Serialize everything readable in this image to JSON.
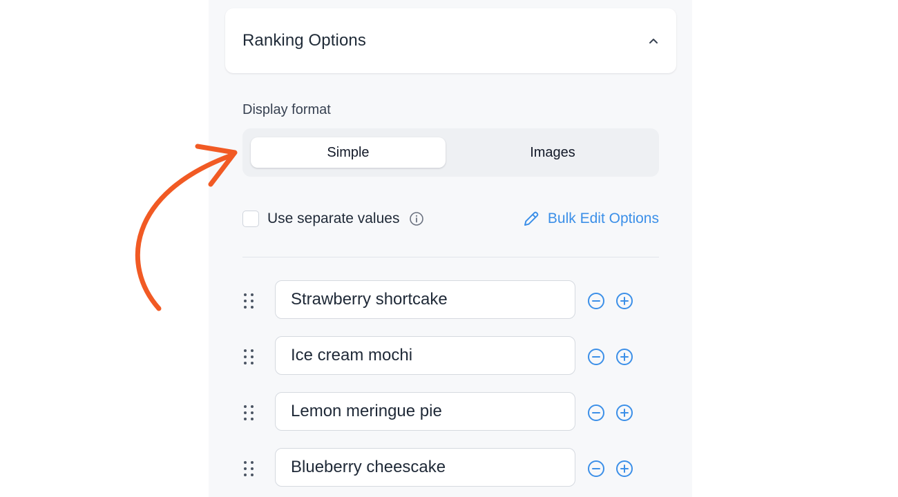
{
  "section": {
    "title": "Ranking Options"
  },
  "display_format": {
    "label": "Display format",
    "options": [
      "Simple",
      "Images"
    ],
    "selected": "Simple"
  },
  "settings": {
    "separate_values_label": "Use separate values",
    "separate_values_checked": false,
    "bulk_edit_label": "Bulk Edit Options"
  },
  "options": [
    {
      "value": "Strawberry shortcake"
    },
    {
      "value": "Ice cream mochi"
    },
    {
      "value": "Lemon meringue pie"
    },
    {
      "value": "Blueberry cheescake"
    }
  ],
  "colors": {
    "accent": "#3b8fe8",
    "annotation": "#f15a24"
  },
  "icons": {
    "collapse": "chevron-up-icon",
    "info": "info-circle-icon",
    "edit": "pencil-icon",
    "drag": "drag-handle-icon",
    "remove": "minus-circle-icon",
    "add": "plus-circle-icon",
    "annotation": "curved-arrow-icon"
  }
}
